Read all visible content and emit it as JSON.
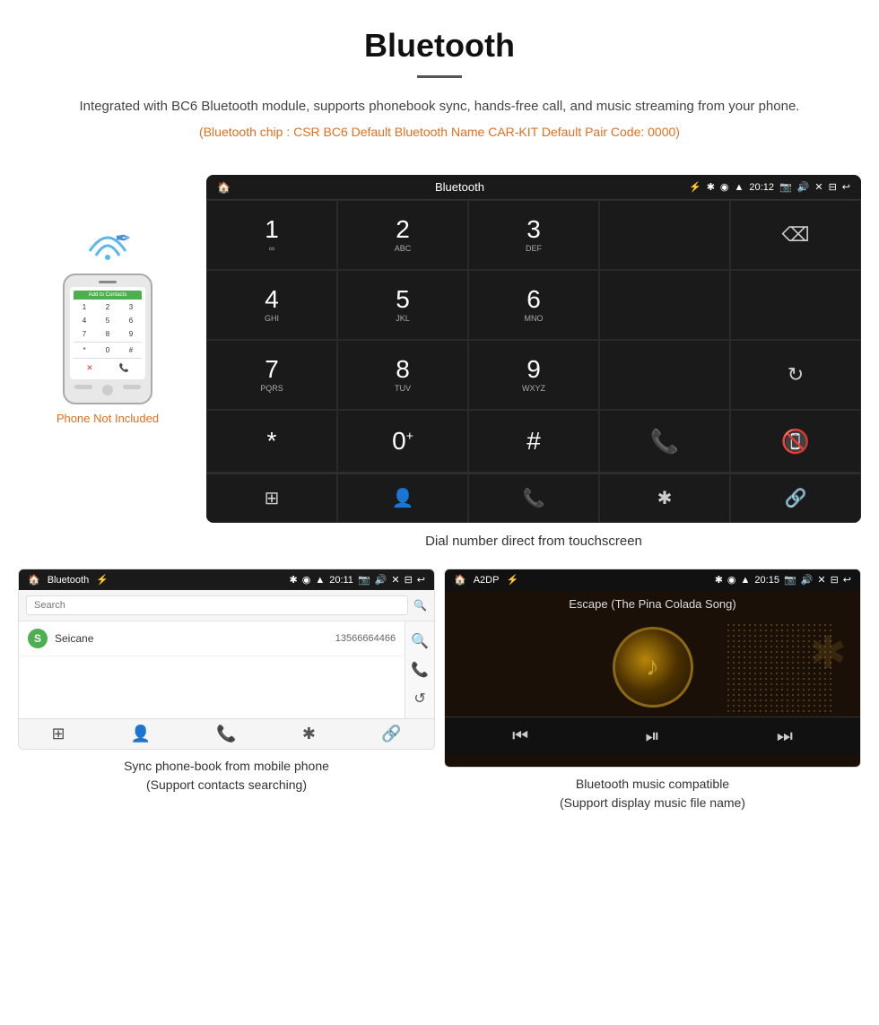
{
  "header": {
    "title": "Bluetooth",
    "description": "Integrated with BC6 Bluetooth module, supports phonebook sync, hands-free call, and music streaming from your phone.",
    "specs": "(Bluetooth chip : CSR BC6    Default Bluetooth Name CAR-KIT    Default Pair Code: 0000)"
  },
  "phone_label": {
    "not": "Phone Not",
    "included": "Included"
  },
  "dial_screen": {
    "status_bar": {
      "left": "🏠",
      "center": "Bluetooth",
      "usb": "⚡",
      "time": "20:12",
      "icons_right": "📷 🔊 ✕ ⊟ ↩"
    },
    "keys": [
      {
        "num": "1",
        "sub": "∞",
        "col": 1
      },
      {
        "num": "2",
        "sub": "ABC",
        "col": 2
      },
      {
        "num": "3",
        "sub": "DEF",
        "col": 3
      },
      {
        "num": "4",
        "sub": "GHI",
        "col": 1
      },
      {
        "num": "5",
        "sub": "JKL",
        "col": 2
      },
      {
        "num": "6",
        "sub": "MNO",
        "col": 3
      },
      {
        "num": "7",
        "sub": "PQRS",
        "col": 1
      },
      {
        "num": "8",
        "sub": "TUV",
        "col": 2
      },
      {
        "num": "9",
        "sub": "WXYZ",
        "col": 3
      },
      {
        "num": "*",
        "sub": "",
        "col": 1
      },
      {
        "num": "0",
        "sub": "+",
        "col": 2
      },
      {
        "num": "#",
        "sub": "",
        "col": 3
      }
    ],
    "caption": "Dial number direct from touchscreen",
    "bottom_icons": [
      "⊞",
      "👤",
      "📞",
      "✱",
      "🔗"
    ]
  },
  "phonebook_screen": {
    "status_bar": {
      "left": "🏠 Bluetooth ⚡",
      "right": "✱ ♦ ▲ 20:11 📷 🔊 ✕ ⊟ ↩"
    },
    "search_placeholder": "Search",
    "contacts": [
      {
        "letter": "S",
        "name": "Seicane",
        "number": "13566664466"
      }
    ],
    "right_icons": [
      "🔍",
      "📞",
      "↺"
    ],
    "bottom_icons": [
      "⊞",
      "👤",
      "📞",
      "✱",
      "🔗"
    ],
    "caption": "Sync phone-book from mobile phone\n(Support contacts searching)"
  },
  "music_screen": {
    "status_bar": {
      "left": "🏠 A2DP ⚡",
      "right": "✱ ♦ ▲ 20:15 📷 🔊 ✕ ⊟ ↩"
    },
    "song_title": "Escape (The Pina Colada Song)",
    "controls": [
      "⏮",
      "⏭▌",
      "⏭"
    ],
    "caption": "Bluetooth music compatible\n(Support display music file name)"
  }
}
